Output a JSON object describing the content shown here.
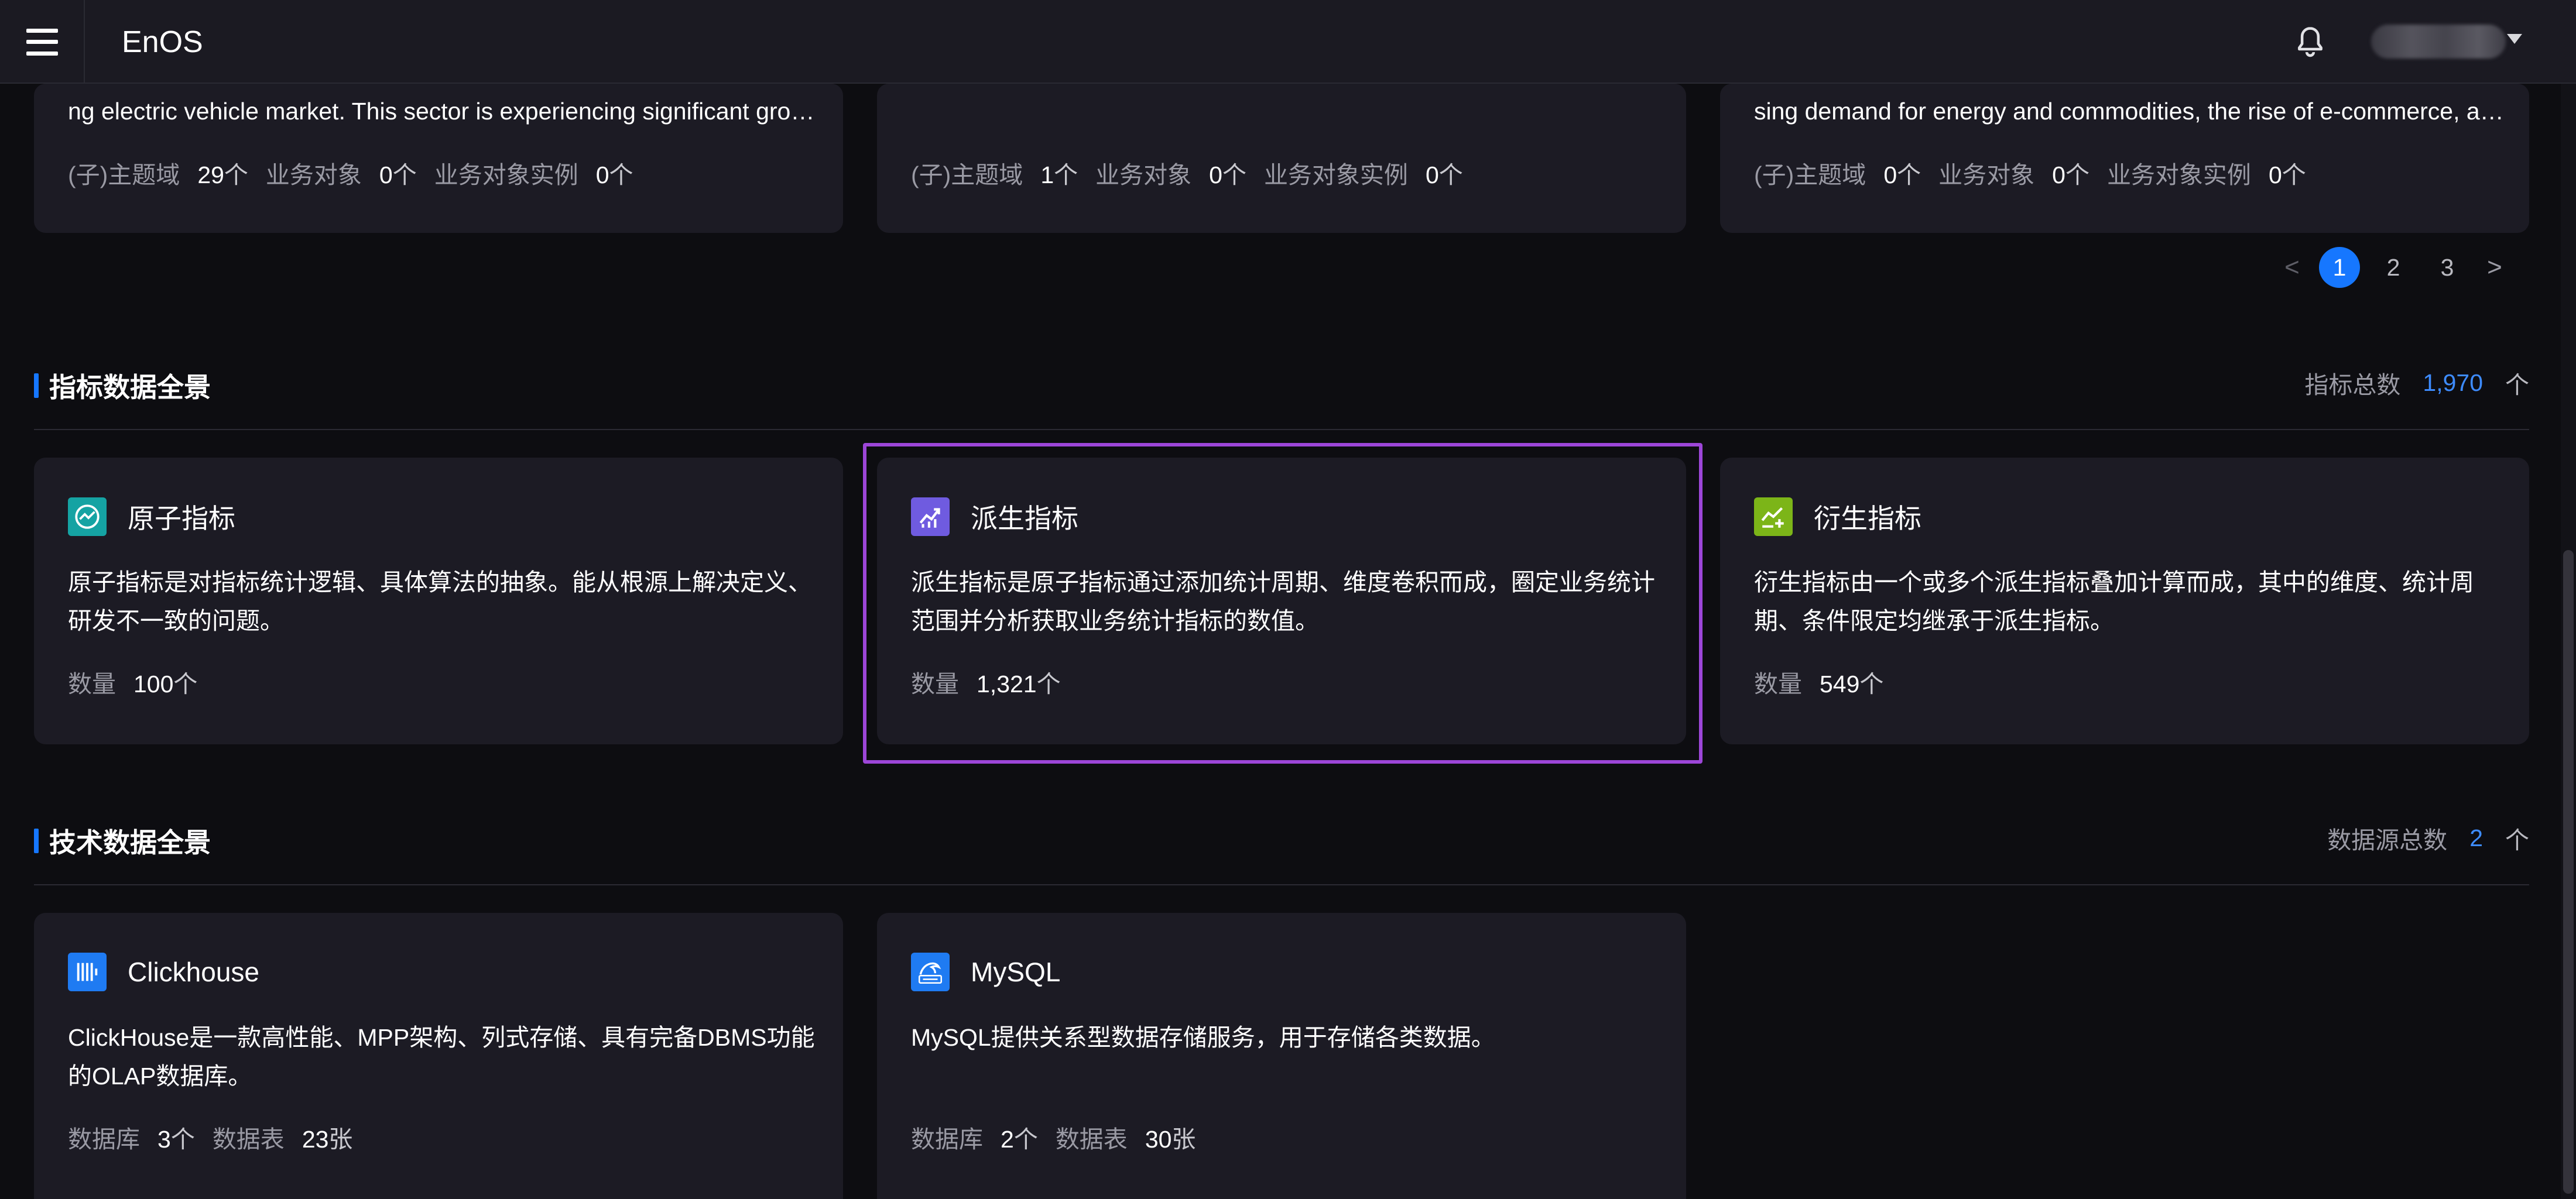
{
  "app": {
    "title": "EnOS"
  },
  "business_cards": [
    {
      "desc": "ng electric vehicle market. This sector is experiencing significant gro…",
      "stats": [
        {
          "label": "(子)主题域",
          "value": "29",
          "unit": "个"
        },
        {
          "label": "业务对象",
          "value": "0",
          "unit": "个"
        },
        {
          "label": "业务对象实例",
          "value": "0",
          "unit": "个"
        }
      ]
    },
    {
      "desc": "",
      "stats": [
        {
          "label": "(子)主题域",
          "value": "1",
          "unit": "个"
        },
        {
          "label": "业务对象",
          "value": "0",
          "unit": "个"
        },
        {
          "label": "业务对象实例",
          "value": "0",
          "unit": "个"
        }
      ]
    },
    {
      "desc": "sing demand for energy and commodities, the rise of e-commerce, a…",
      "stats": [
        {
          "label": "(子)主题域",
          "value": "0",
          "unit": "个"
        },
        {
          "label": "业务对象",
          "value": "0",
          "unit": "个"
        },
        {
          "label": "业务对象实例",
          "value": "0",
          "unit": "个"
        }
      ]
    }
  ],
  "pagination": {
    "prev": "<",
    "next": ">",
    "pages": [
      "1",
      "2",
      "3"
    ],
    "current": "1"
  },
  "metrics_section": {
    "title": "指标数据全景",
    "total_label": "指标总数",
    "total_value": "1,970",
    "total_unit": "个",
    "cards": [
      {
        "icon": "trend-line-icon",
        "color": "#15a3a3",
        "title": "原子指标",
        "desc": "原子指标是对指标统计逻辑、具体算法的抽象。能从根源上解决定义、研发不一致的问题。",
        "count_label": "数量",
        "count_value": "100",
        "count_unit": "个"
      },
      {
        "icon": "growth-chart-icon",
        "color": "#6f5be0",
        "title": "派生指标",
        "desc": "派生指标是原子指标通过添加统计周期、维度卷积而成，圈定业务统计范围并分析获取业务统计指标的数值。",
        "count_label": "数量",
        "count_value": "1,321",
        "count_unit": "个"
      },
      {
        "icon": "chart-plus-icon",
        "color": "#7cb518",
        "title": "衍生指标",
        "desc": "衍生指标由一个或多个派生指标叠加计算而成，其中的维度、统计周期、条件限定均继承于派生指标。",
        "count_label": "数量",
        "count_value": "549",
        "count_unit": "个"
      }
    ]
  },
  "tech_section": {
    "title": "技术数据全景",
    "total_label": "数据源总数",
    "total_value": "2",
    "total_unit": "个",
    "cards": [
      {
        "icon": "clickhouse-icon",
        "color": "#1f7bf2",
        "title": "Clickhouse",
        "desc": "ClickHouse是一款高性能、MPP架构、列式存储、具有完备DBMS功能的OLAP数据库。",
        "stats": [
          {
            "label": "数据库",
            "value": "3",
            "unit": "个"
          },
          {
            "label": "数据表",
            "value": "23",
            "unit": "张"
          }
        ]
      },
      {
        "icon": "mysql-icon",
        "color": "#1f7bf2",
        "title": "MySQL",
        "desc": "MySQL提供关系型数据存储服务，用于存储各类数据。",
        "stats": [
          {
            "label": "数据库",
            "value": "2",
            "unit": "个"
          },
          {
            "label": "数据表",
            "value": "30",
            "unit": "张"
          }
        ]
      }
    ]
  }
}
